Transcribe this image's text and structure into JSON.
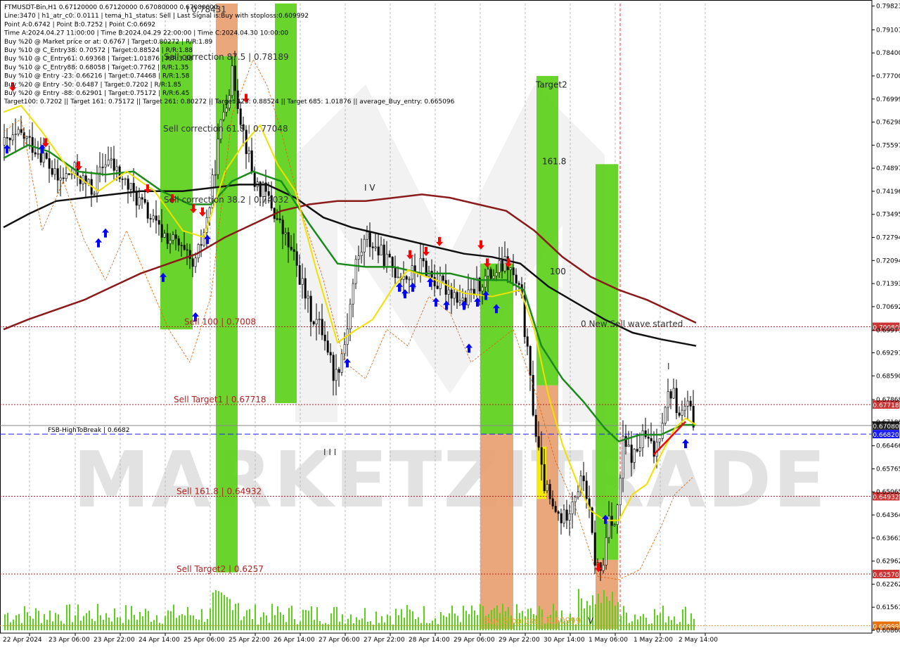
{
  "chart_data": {
    "type": "candlestick",
    "symbol_header": "FTMUSDT-Bin,H1  0.67120000 0.67120000 0.67080000 0.67080000",
    "info_lines": [
      "Line:3470  |  h1_atr_c0: 0.0111  |  tema_h1_status: Sell  |  Last Signal is:Buy with stoploss:0.609992",
      "Point A:0.6742  |  Point B:0.7252  |  Point C:0.6692",
      "Time A:2024.04.27 11:00:00  |  Time B:2024.04.29 22:00:00  |  Time C:2024.04.30 10:00:00",
      "Buy %20 @ Market price or at: 0.6767  |  Target:0.80272  |  R/R:1.89",
      "Buy %10 @ C_Entry38: 0.70572  |  Target:0.88524  |  R/R:1.88",
      "Buy %10 @ C_Entry61: 0.69368  |  Target:1.01876  |  R/R:3.88",
      "Buy %10 @ C_Entry88: 0.68058  |  Target:0.7762  |  R/R:1.35",
      "Buy %10 @ Entry -23: 0.66216  |  Target:0.74468  |  R/R:1.58",
      "Buy %20 @ Entry -50: 0.6487  |  Target:0.7202  |  R/R:1.85",
      "Buy %20 @ Entry -88: 0.62901  |  Target:0.75172  |  R/R:6.45",
      "Target100: 0.7202  ||  Target 161: 0.75172  ||  Target 261: 0.80272  ||  Target 423: 0.88524  ||  Target 685: 1.01876  ||  average_Buy_entry: 0.665096"
    ],
    "price_axis_ticks": [
      "0.79823",
      "0.79101",
      "0.78400",
      "0.77700",
      "0.76999",
      "0.76298",
      "0.75597",
      "0.74897",
      "0.74196",
      "0.73495",
      "0.72794",
      "0.72094",
      "0.71393",
      "0.70692",
      "0.69971",
      "0.69291",
      "0.68590",
      "0.67868",
      "0.67188",
      "0.66466",
      "0.65765",
      "0.65065",
      "0.64364",
      "0.63663",
      "0.62962",
      "0.62262",
      "0.61561",
      "0.60860"
    ],
    "time_axis_labels": [
      "22 Apr 2024",
      "23 Apr 06:00",
      "23 Apr 22:00",
      "24 Apr 14:00",
      "25 Apr 06:00",
      "25 Apr 22:00",
      "26 Apr 14:00",
      "27 Apr 06:00",
      "27 Apr 22:00",
      "28 Apr 14:00",
      "29 Apr 06:00",
      "29 Apr 22:00",
      "30 Apr 14:00",
      "1 May 06:00",
      "1 May 22:00",
      "2 May 14:00"
    ],
    "y_range": [
      0.6086,
      0.799
    ],
    "horizontal_levels": [
      {
        "label": "Sell 100 | 0.7008",
        "value": 0.7008,
        "badge": "0.70080",
        "color": "#b22222"
      },
      {
        "label": "Sell Target1 | 0.67718",
        "value": 0.67718,
        "badge": "0.67718",
        "color": "#b22222"
      },
      {
        "label": "FSB-HighToBreak | 0.6682",
        "value": 0.6682,
        "badge": "0.66820",
        "color": "#1a1aff"
      },
      {
        "label": "Sell 161.8 | 0.64932",
        "value": 0.64932,
        "badge": "0.64932",
        "color": "#b22222"
      },
      {
        "label": "Sell Target2 | 0.6257",
        "value": 0.6257,
        "badge": "0.62570",
        "color": "#b22222"
      },
      {
        "label": "Buy Stoploss | 0.60999",
        "value": 0.60999,
        "badge": "0.60999",
        "color": "#e6a23c"
      }
    ],
    "current_price": {
      "value": 0.6708,
      "badge": "0.67080"
    },
    "chart_texts": [
      {
        "text": "Sell correction 87.5 | 0.78189",
        "price": 0.7819
      },
      {
        "text": "Sell correction 61.8 | 0.77048",
        "price": 0.7601
      },
      {
        "text": "Sell correction 38.2 | 0.74032",
        "price": 0.7385
      },
      {
        "text": "I V",
        "price": 0.7422
      },
      {
        "text": "Target2",
        "price": 0.7735
      },
      {
        "text": "161.8",
        "price": 0.7502
      },
      {
        "text": "100",
        "price": 0.7167
      },
      {
        "text": "0 New Sell wave started",
        "price": 0.7008
      },
      {
        "text": "I I I",
        "price": 0.6618
      },
      {
        "text": "I",
        "price": 0.6879
      },
      {
        "text": "V",
        "price": 0.6106
      },
      {
        "text": "I  0.78431",
        "price": 0.7963
      }
    ],
    "watermark": "MARKETZITRADE",
    "series": [
      {
        "name": "open-price-line",
        "color": "#000000"
      },
      {
        "name": "tema-fast",
        "color": "#f0e000"
      },
      {
        "name": "ema-medium",
        "color": "#008000"
      },
      {
        "name": "ema-slow",
        "color": "#8b1a1a"
      }
    ],
    "colors": {
      "bull_candle": "#000000",
      "bear_candle": "#000000",
      "green_zone": "#5cd11a",
      "orange_zone": "#e8a070",
      "yellow_zone": "#f5f000",
      "buy_arrow": "#0000ff",
      "sell_arrow": "#ff0000",
      "volume": "#5cd11a",
      "level_line": "#b22222",
      "dashed_line": "#1a1aff",
      "badge_red": "#cc3333",
      "badge_blue": "#1a1aff"
    }
  }
}
